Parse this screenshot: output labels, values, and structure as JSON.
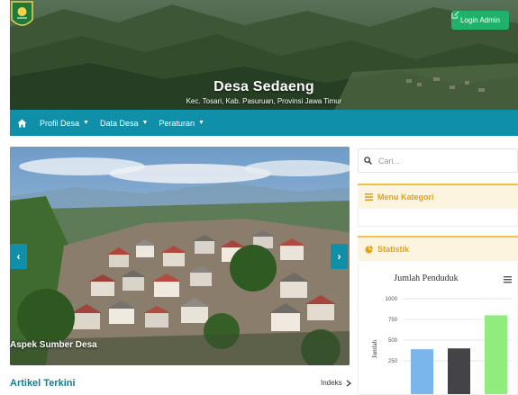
{
  "header": {
    "login_label": "Login Admin",
    "title": "Desa Sedaeng",
    "subtitle": "Kec. Tosari, Kab. Pasuruan, Provinsi Jawa Timur"
  },
  "nav": {
    "items": [
      {
        "label": "Profil Desa"
      },
      {
        "label": "Data Desa"
      },
      {
        "label": "Peraturan"
      }
    ]
  },
  "slider": {
    "caption": "Aspek Sumber Desa",
    "prev_glyph": "‹",
    "next_glyph": "›"
  },
  "articles": {
    "title": "Artikel Terkini",
    "index_label": "Indeks"
  },
  "sidebar": {
    "search_placeholder": "Cari...",
    "kategori_title": "Menu Kategori",
    "statistik_title": "Statistik"
  },
  "colors": {
    "nav": "#0f8fa8",
    "login": "#20b26a",
    "panel_accent": "#e0a21b"
  },
  "chart_data": {
    "type": "bar",
    "title": "Jumlah Penduduk",
    "ylabel": "Jumlah",
    "yticks": [
      250,
      500,
      750,
      1000
    ],
    "ylim": [
      0,
      1000
    ],
    "series": [
      {
        "values": [
          390
        ],
        "color": "#7cb5ec"
      },
      {
        "values": [
          400
        ],
        "color": "#434348"
      },
      {
        "values": [
          800
        ],
        "color": "#90ed7d"
      }
    ]
  }
}
